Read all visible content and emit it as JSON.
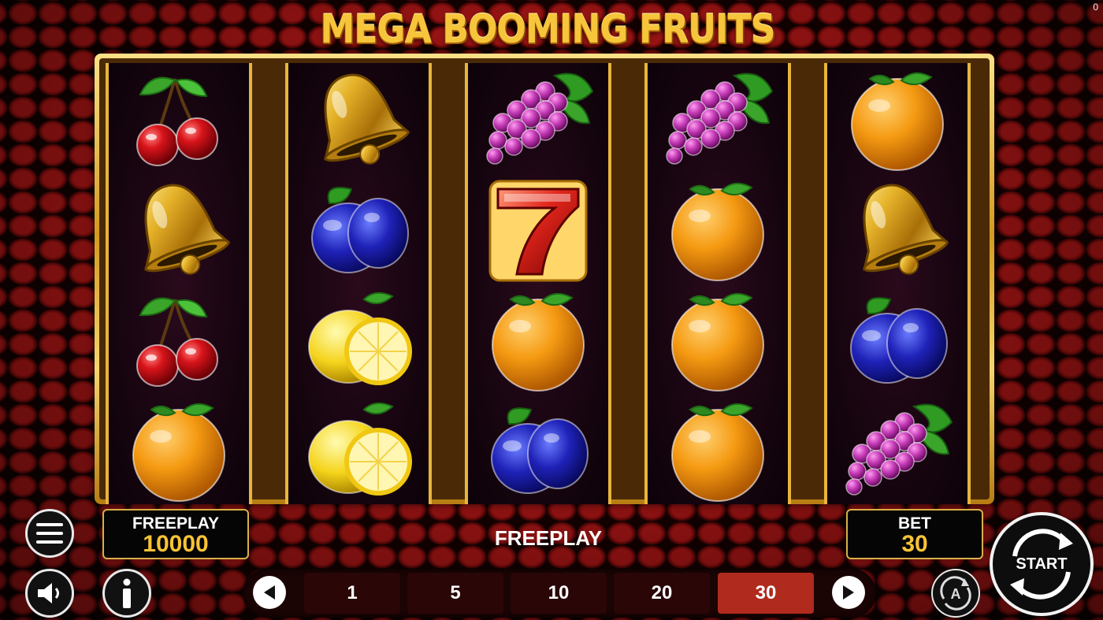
{
  "corner_counter": "0",
  "title": "MEGA BOOMING FRUITS",
  "reels": [
    [
      "cherry",
      "bell",
      "cherry",
      "orange"
    ],
    [
      "bell",
      "plum",
      "lemon",
      "lemon"
    ],
    [
      "grapes",
      "seven",
      "orange",
      "plum"
    ],
    [
      "grapes",
      "orange",
      "orange",
      "orange"
    ],
    [
      "orange",
      "bell",
      "plum",
      "grapes"
    ]
  ],
  "balance": {
    "label": "FREEPLAY",
    "value": "10000"
  },
  "message": "FREEPLAY",
  "bet": {
    "label": "BET",
    "value": "30"
  },
  "bet_options": [
    "1",
    "5",
    "10",
    "20",
    "30"
  ],
  "selected_bet": "30",
  "start_label": "START",
  "icons": {
    "menu": "hamburger-menu-icon",
    "sound": "speaker-icon",
    "info": "info-icon",
    "prev": "arrow-left-icon",
    "next": "arrow-right-icon",
    "autoplay": "autoplay-icon",
    "start": "start-spin-icon"
  },
  "colors": {
    "gold": "#f6c53a",
    "frame_gold": "#e9b43c",
    "selected_bet_bg": "#b02a1e",
    "background_red": "#c01818"
  }
}
